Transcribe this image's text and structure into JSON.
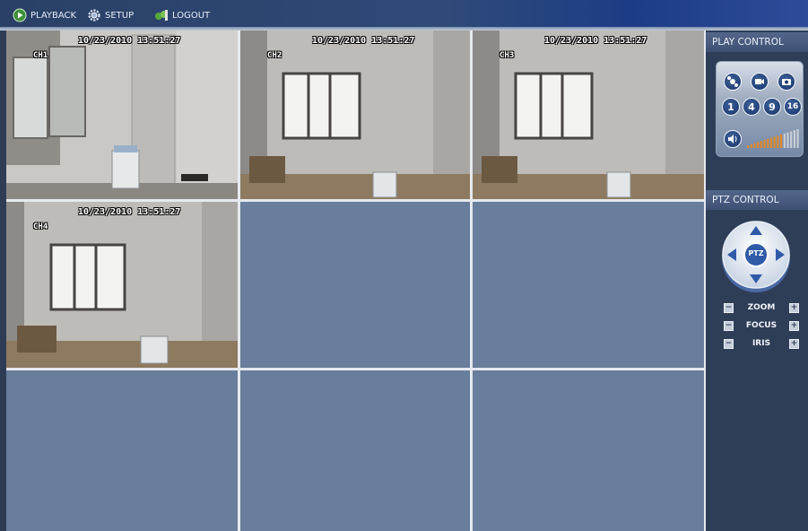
{
  "topbar": {
    "items": [
      {
        "label": "PLAYBACK",
        "icon": "playback-icon"
      },
      {
        "label": "SETUP",
        "icon": "gear-icon"
      },
      {
        "label": "LOGOUT",
        "icon": "logout-icon"
      }
    ]
  },
  "cameras": [
    {
      "channel": "CH1",
      "timestamp": "10/23/2010  13:51:27",
      "selected": true
    },
    {
      "channel": "CH2",
      "timestamp": "10/23/2010  13:51:27",
      "selected": false
    },
    {
      "channel": "CH3",
      "timestamp": "10/23/2010  13:51:27",
      "selected": false
    },
    {
      "channel": "CH4",
      "timestamp": "10/23/2010  13:51:27",
      "selected": false
    }
  ],
  "play_control": {
    "title": "PLAY CONTROL",
    "buttons": [
      "record-icon",
      "camera-icon",
      "snapshot-icon"
    ],
    "split_buttons": [
      "1",
      "4",
      "9",
      "16"
    ],
    "volume_icon": "speaker-icon"
  },
  "ptz_control": {
    "title": "PTZ CONTROL",
    "center_label": "PTZ",
    "controls": [
      "ZOOM",
      "FOCUS",
      "IRIS"
    ],
    "minus": "−",
    "plus": "+"
  },
  "colors": {
    "empty_cell": "#687e9c",
    "selected_border": "#b23a43",
    "panel_bg": "#2f3e57"
  }
}
